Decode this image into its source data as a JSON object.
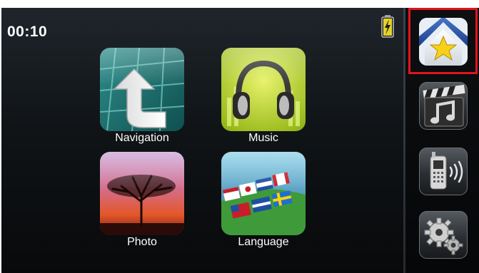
{
  "status": {
    "time": "00:10",
    "battery_icon": "battery-charging-icon"
  },
  "apps": [
    {
      "label": "Navigation",
      "icon": "navigation-icon"
    },
    {
      "label": "Music",
      "icon": "headphones-icon"
    },
    {
      "label": "Photo",
      "icon": "sunset-tree-icon"
    },
    {
      "label": "Language",
      "icon": "flags-icon"
    }
  ],
  "sidebar": {
    "items": [
      {
        "icon": "home-favorite-icon",
        "selected": true
      },
      {
        "icon": "media-clapper-music-icon",
        "selected": false
      },
      {
        "icon": "phone-bluetooth-icon",
        "selected": false
      },
      {
        "icon": "settings-gears-icon",
        "selected": false
      }
    ]
  },
  "colors": {
    "selection_outline": "#e1141c",
    "background": "#000000"
  }
}
